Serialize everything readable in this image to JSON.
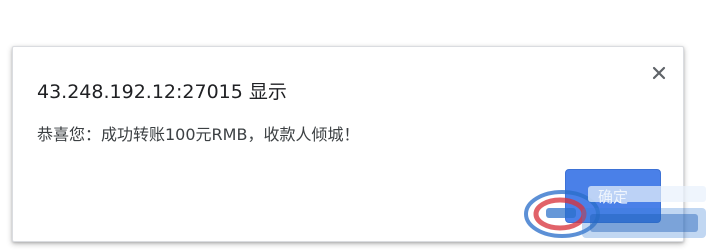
{
  "dialog": {
    "title": "43.248.192.12:27015 显示",
    "message": "恭喜您：成功转账100元RMB，收款人倾城！",
    "ok_label": "确定"
  },
  "icons": {
    "close": "close-icon"
  },
  "colors": {
    "ok_button": "#4a80e8",
    "title_text": "#202124",
    "message_text": "#3c4043"
  }
}
